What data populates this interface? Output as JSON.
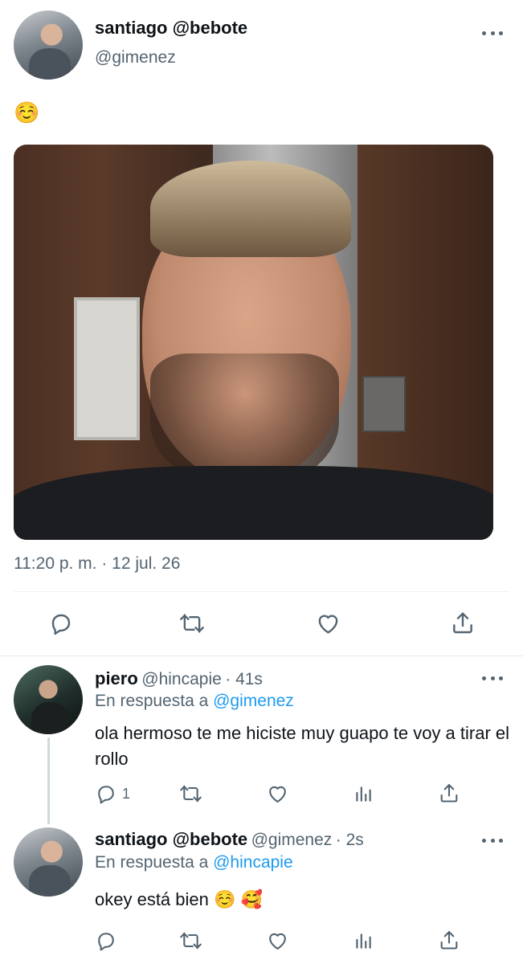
{
  "main_tweet": {
    "display_name": "santiago @bebote",
    "handle": "@gimenez",
    "text": "☺️",
    "timestamp": "11:20 p. m. · 12 jul. 26",
    "more_icon": "more-dots-icon",
    "actions": [
      "reply-icon",
      "retweet-icon",
      "like-icon",
      "share-icon"
    ]
  },
  "replies": [
    {
      "display_name": "piero",
      "handle": "@hincapie",
      "time": "· 41s",
      "reply_prefix": "En respuesta a",
      "reply_mention": "@gimenez",
      "text": "ola hermoso te me hiciste muy guapo te voy a tirar el rollo",
      "reply_count": "1"
    },
    {
      "display_name": "santiago @bebote",
      "handle": "@gimenez",
      "time": "· 2s",
      "reply_prefix": "En respuesta a",
      "reply_mention": "@hincapie",
      "text": "okey está bien ☺️ 🥰",
      "reply_count": ""
    }
  ],
  "colors": {
    "text_primary": "#0f1419",
    "text_secondary": "#536471",
    "link": "#1d9bf0",
    "divider": "#eff3f4"
  }
}
